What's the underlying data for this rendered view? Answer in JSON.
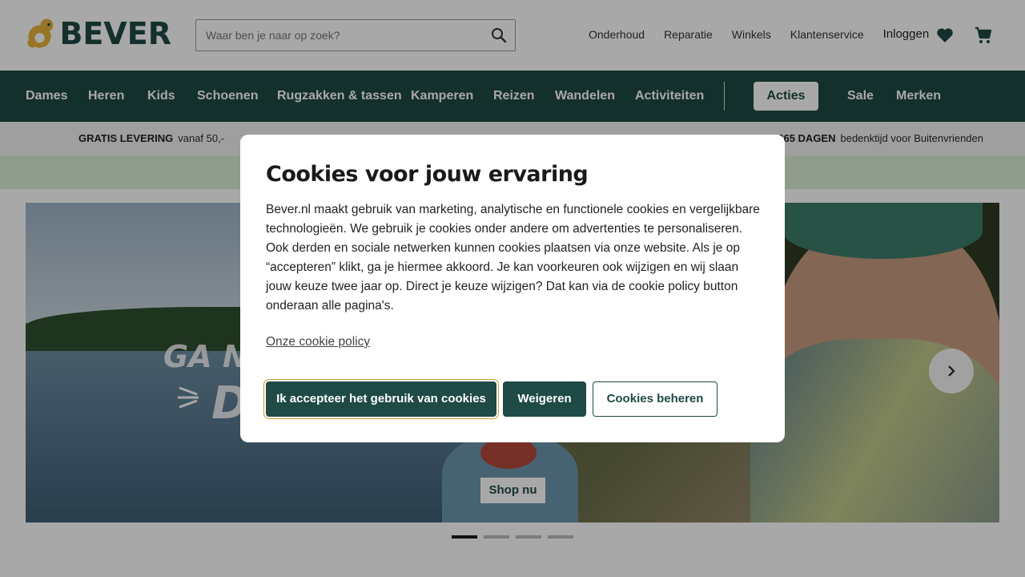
{
  "brand": {
    "name": "BEVER",
    "accent": "#1f4a45",
    "logo_yellow": "#e5b23a"
  },
  "header": {
    "search_placeholder": "Waar ben je naar op zoek?",
    "links": [
      "Onderhoud",
      "Reparatie",
      "Winkels",
      "Klantenservice"
    ],
    "login": "Inloggen",
    "icons": [
      "search-icon",
      "heart-icon",
      "cart-icon"
    ]
  },
  "nav": {
    "items": [
      "Dames",
      "Heren",
      "Kids",
      "Schoenen",
      "Rugzakken & tassen",
      "Kamperen",
      "Reizen",
      "Wandelen",
      "Activiteiten"
    ],
    "acties": "Acties",
    "sale": "Sale",
    "merken": "Merken"
  },
  "usp": {
    "left_bold": "GRATIS LEVERING",
    "left_text": "vanaf 50,-",
    "right_bold": "365 DAGEN",
    "right_text": "bedenktijd voor Buitenvrienden"
  },
  "hero": {
    "headline_line1": "GA NA",
    "headline_line2": "D",
    "cta": "Shop nu",
    "slides": 4,
    "active_slide": 1
  },
  "cookie_modal": {
    "title": "Cookies voor jouw ervaring",
    "body": "Bever.nl maakt gebruik van marketing, analytische en functionele cookies en vergelijkbare technologieën. We gebruik je cookies onder andere om advertenties te personaliseren. Ook derden en sociale netwerken kunnen cookies plaatsen via onze website. Als je op “accepteren” klikt, ga je hiermee akkoord. Je kan voorkeuren ook wijzigen en wij slaan jouw keuze twee jaar op. Direct je keuze wijzigen? Dat kan via de cookie policy button onderaan alle pagina's.",
    "policy_link": "Onze cookie policy",
    "accept": "Ik accepteer het gebruik van cookies",
    "refuse": "Weigeren",
    "manage": "Cookies beheren"
  }
}
